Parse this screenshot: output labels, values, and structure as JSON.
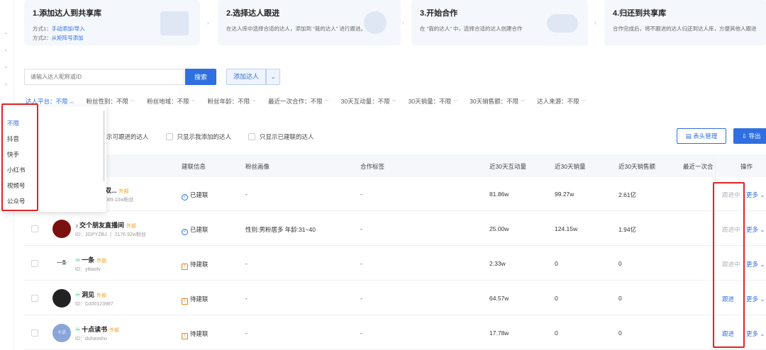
{
  "steps": [
    {
      "title": "1.添加达人到共享库",
      "line1_prefix": "方式1：",
      "line1_link": "手动添加/导入",
      "line2_prefix": "方式2：",
      "line2_link": "从矩阵号添加"
    },
    {
      "title": "2.选择达人跟进",
      "desc": "在达人库中选择合适的达人，添加到 \"我的达人\" 进行跟进。"
    },
    {
      "title": "3.开始合作",
      "desc": "在 \"我的达人\" 中，选择合适的达人创建合作"
    },
    {
      "title": "4.归还到共享库",
      "desc": "合作完成后，将不跟进的达人归还到达人库，方便其他人跟进"
    }
  ],
  "search": {
    "placeholder": "请输入达人昵称或ID",
    "button": "搜索"
  },
  "add_button": "添加达人",
  "filters": [
    "达人平台：不限",
    "粉丝性别：不限",
    "粉丝地域：不限",
    "粉丝年龄：不限",
    "最近一次合作：不限",
    "30天互动量：不限",
    "30天销量：不限",
    "30天销售额：不限",
    "达人来源：不限"
  ],
  "platform_dropdown": [
    "不限",
    "抖音",
    "快手",
    "小红书",
    "视频号",
    "公众号"
  ],
  "checkboxes": [
    "示可跟进的达人",
    "只显示我添加的达人",
    "只显示已建联的达人"
  ],
  "toolbar": {
    "table_manage": "表头管理",
    "export": "导出"
  },
  "columns": [
    "建联信息",
    "粉丝画像",
    "合作标签",
    "近30天互动量",
    "近30天销量",
    "近30天销售额",
    "最近一次合",
    "操作"
  ],
  "rows": [
    {
      "name": "20号早8点双...",
      "badge": "外部",
      "sub": "uan1991 丨 1689.10w粉丝",
      "status": "已建联",
      "fans": "-",
      "tag": "-",
      "interact": "81.86w",
      "sales": "99.27w",
      "revenue": "2.61亿",
      "action": "跟进中",
      "more": "更多"
    },
    {
      "name": "交个朋友直播间",
      "badge": "外部",
      "sub": "ID：JGPYZBJ 丨 2176.92w粉丝",
      "status": "已建联",
      "fans": "性别:男粉居多 年龄:31~40",
      "tag": "-",
      "interact": "25.00w",
      "sales": "124.15w",
      "revenue": "1.94亿",
      "action": "跟进中",
      "more": "更多"
    },
    {
      "name": "一条",
      "badge": "外部",
      "sub": "ID：yitiaotv",
      "status": "待建联",
      "fans": "-",
      "tag": "-",
      "interact": "2.33w",
      "sales": "0",
      "revenue": "0",
      "action": "跟进中",
      "more": "更多"
    },
    {
      "name": "洞见",
      "badge": "外部",
      "sub": "ID：DJ00123987",
      "status": "待建联",
      "fans": "-",
      "tag": "-",
      "interact": "64.57w",
      "sales": "0",
      "revenue": "0",
      "action": "跟进",
      "more": "更多"
    },
    {
      "name": "十点读书",
      "badge": "外部",
      "sub": "ID：duhaoshu",
      "status": "待建联",
      "fans": "-",
      "tag": "-",
      "interact": "17.78w",
      "sales": "0",
      "revenue": "0",
      "action": "跟进",
      "more": "更多"
    }
  ]
}
